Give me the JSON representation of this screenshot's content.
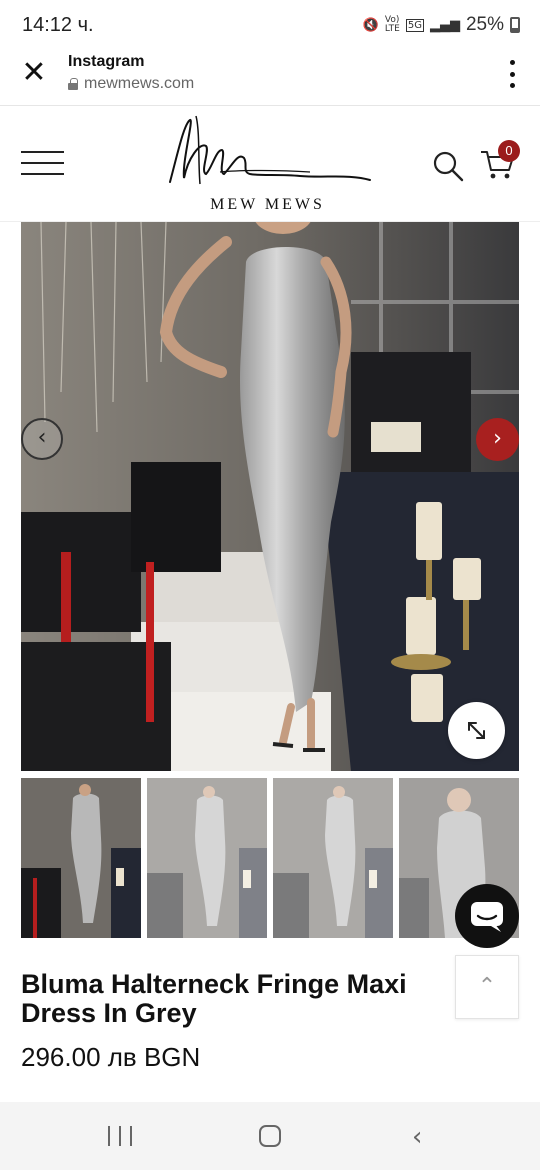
{
  "status_bar": {
    "time": "14:12 ч.",
    "network": "5G",
    "battery": "25%"
  },
  "browser": {
    "title": "Instagram",
    "url": "mewmews.com"
  },
  "site": {
    "logo_text": "MEW MEWS",
    "cart_count": "0",
    "brand_color": "#9b1c1c"
  },
  "gallery": {
    "main_image": "product-photo-silver-fringe-dress",
    "thumbnail_count": 4,
    "accent_color": "#a8201f"
  },
  "product": {
    "title": "Bluma Halterneck Fringe Maxi Dress In Grey",
    "price": "296.00 лв BGN"
  },
  "icons": {
    "close": "close-icon",
    "menu": "more-vert-icon",
    "hamburger": "hamburger-icon",
    "search": "search-icon",
    "cart": "cart-icon",
    "prev": "chevron-left-icon",
    "next": "chevron-right-icon",
    "zoom": "expand-icon",
    "chat": "chat-icon",
    "scroll_top": "chevron-up-icon"
  }
}
